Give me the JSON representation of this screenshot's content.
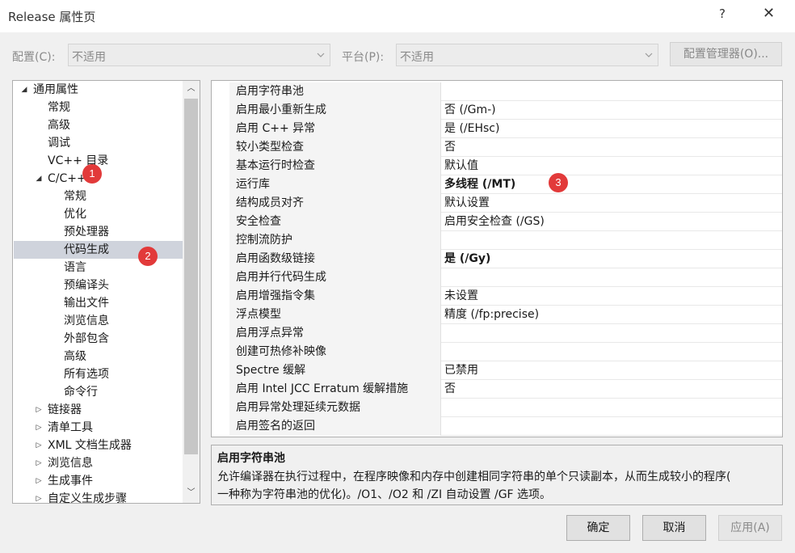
{
  "window": {
    "title": "Release 属性页",
    "help": "?",
    "close": "✕"
  },
  "config": {
    "config_label": "配置(C):",
    "config_value": "不适用",
    "platform_label": "平台(P):",
    "platform_value": "不适用",
    "manager_button": "配置管理器(O)..."
  },
  "tree": {
    "items": [
      {
        "label": "通用属性",
        "expander": "◢",
        "level": 0
      },
      {
        "label": "常规",
        "expander": "",
        "level": 1
      },
      {
        "label": "高级",
        "expander": "",
        "level": 1
      },
      {
        "label": "调试",
        "expander": "",
        "level": 1
      },
      {
        "label": "VC++ 目录",
        "expander": "",
        "level": 1
      },
      {
        "label": "C/C++",
        "expander": "◢",
        "level": 1
      },
      {
        "label": "常规",
        "expander": "",
        "level": 2
      },
      {
        "label": "优化",
        "expander": "",
        "level": 2
      },
      {
        "label": "预处理器",
        "expander": "",
        "level": 2
      },
      {
        "label": "代码生成",
        "expander": "",
        "level": 2
      },
      {
        "label": "语言",
        "expander": "",
        "level": 2
      },
      {
        "label": "预编译头",
        "expander": "",
        "level": 2
      },
      {
        "label": "输出文件",
        "expander": "",
        "level": 2
      },
      {
        "label": "浏览信息",
        "expander": "",
        "level": 2
      },
      {
        "label": "外部包含",
        "expander": "",
        "level": 2
      },
      {
        "label": "高级",
        "expander": "",
        "level": 2
      },
      {
        "label": "所有选项",
        "expander": "",
        "level": 2
      },
      {
        "label": "命令行",
        "expander": "",
        "level": 2
      },
      {
        "label": "链接器",
        "expander": "▷",
        "level": 1
      },
      {
        "label": "清单工具",
        "expander": "▷",
        "level": 1
      },
      {
        "label": "XML 文档生成器",
        "expander": "▷",
        "level": 1
      },
      {
        "label": "浏览信息",
        "expander": "▷",
        "level": 1
      },
      {
        "label": "生成事件",
        "expander": "▷",
        "level": 1
      },
      {
        "label": "自定义生成步骤",
        "expander": "▷",
        "level": 1
      }
    ],
    "selected_index": 9,
    "scroll_up": "︿",
    "scroll_down": "﹀"
  },
  "grid": {
    "rows": [
      {
        "name": "启用字符串池",
        "value": "",
        "bold": false
      },
      {
        "name": "启用最小重新生成",
        "value": "否 (/Gm-)",
        "bold": false
      },
      {
        "name": "启用 C++ 异常",
        "value": "是 (/EHsc)",
        "bold": false
      },
      {
        "name": "较小类型检查",
        "value": "否",
        "bold": false
      },
      {
        "name": "基本运行时检查",
        "value": "默认值",
        "bold": false
      },
      {
        "name": "运行库",
        "value": "多线程 (/MT)",
        "bold": true
      },
      {
        "name": "结构成员对齐",
        "value": "默认设置",
        "bold": false
      },
      {
        "name": "安全检查",
        "value": "启用安全检查 (/GS)",
        "bold": false
      },
      {
        "name": "控制流防护",
        "value": "",
        "bold": false
      },
      {
        "name": "启用函数级链接",
        "value": "是 (/Gy)",
        "bold": true
      },
      {
        "name": "启用并行代码生成",
        "value": "",
        "bold": false
      },
      {
        "name": "启用增强指令集",
        "value": "未设置",
        "bold": false
      },
      {
        "name": "浮点模型",
        "value": "精度 (/fp:precise)",
        "bold": false
      },
      {
        "name": "启用浮点异常",
        "value": "",
        "bold": false
      },
      {
        "name": "创建可热修补映像",
        "value": "",
        "bold": false
      },
      {
        "name": "Spectre 缓解",
        "value": "已禁用",
        "bold": false
      },
      {
        "name": "启用 Intel JCC Erratum 缓解措施",
        "value": "否",
        "bold": false
      },
      {
        "name": "启用异常处理延续元数据",
        "value": "",
        "bold": false
      },
      {
        "name": "启用签名的返回",
        "value": "",
        "bold": false
      }
    ]
  },
  "description": {
    "title": "启用字符串池",
    "line1": "允许编译器在执行过程中，在程序映像和内存中创建相同字符串的单个只读副本，从而生成较小的程序(",
    "line2": "一种称为字符串池的优化)。/O1、/O2 和 /ZI 自动设置 /GF 选项。"
  },
  "buttons": {
    "ok": "确定",
    "cancel": "取消",
    "apply": "应用(A)"
  },
  "annotations": {
    "badge1": "1",
    "badge2": "2",
    "badge3": "3"
  },
  "colors": {
    "badge": "#e23a3a",
    "selection": "#cfd3dc"
  }
}
